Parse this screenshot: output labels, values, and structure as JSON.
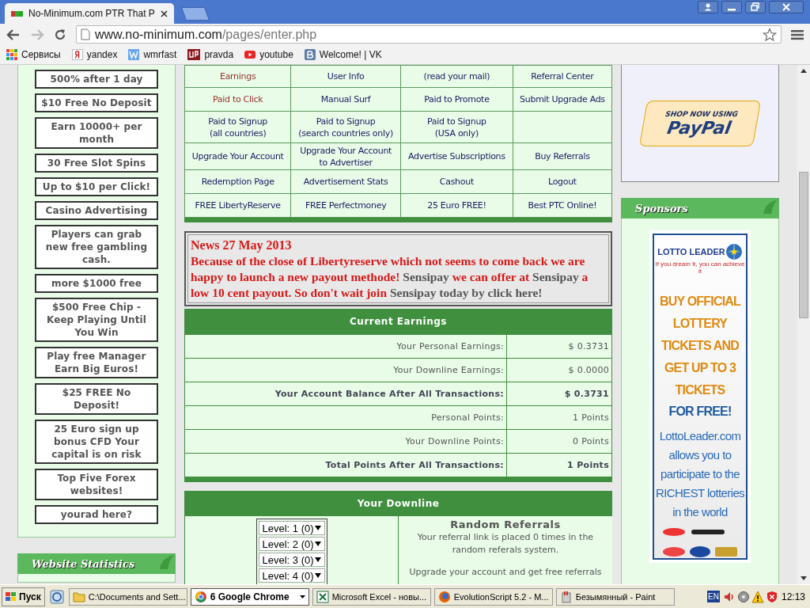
{
  "browser": {
    "tab": {
      "title": "No-Minimum.com PTR That P"
    },
    "url": {
      "host": "www.no-minimum.com",
      "path": "/pages/enter.php"
    },
    "bookmarks": [
      {
        "label": "Сервисы",
        "kind": "apps"
      },
      {
        "label": "yandex",
        "kind": "yandex"
      },
      {
        "label": "wmrfast",
        "kind": "w"
      },
      {
        "label": "pravda",
        "kind": "up"
      },
      {
        "label": "youtube",
        "kind": "youtube"
      },
      {
        "label": "Welcome! | VK",
        "kind": "vk"
      }
    ]
  },
  "left": {
    "banners": [
      "500% after 1 day",
      "$10 Free No Deposit",
      "Earn 10000+ per month",
      "30 Free Slot Spins",
      "Up to $10 per Click!",
      "Casino Advertising",
      "Players can grab new free gambling cash.",
      "more $1000 free",
      "$500 Free Chip - Keep Playing Until You Win",
      "Play free Manager Earn Big Euros!",
      "$25 FREE No Deposit!",
      "25 Euro sign up bonus CFD Your capital is on risk",
      "Top Five Forex websites!",
      "yourad here?"
    ],
    "stats_title": "Website Statistics"
  },
  "nav": {
    "rows": [
      [
        {
          "label": "Earnings",
          "visited": true
        },
        {
          "label": "User Info",
          "visited": false
        },
        {
          "label": "(read your mail)",
          "visited": false
        },
        {
          "label": "Referral Center",
          "visited": false
        }
      ],
      [
        {
          "label": "Paid to Click",
          "visited": true
        },
        {
          "label": "Manual Surf",
          "visited": false
        },
        {
          "label": "Paid to Promote",
          "visited": false
        },
        {
          "label": "Submit Upgrade Ads",
          "visited": false
        }
      ],
      [
        {
          "label": "Paid to Signup\n(all countries)",
          "visited": false
        },
        {
          "label": "Paid to Signup\n(search countries only)",
          "visited": false
        },
        {
          "label": "Paid to Signup\n(USA only)",
          "visited": false
        },
        null
      ],
      [
        {
          "label": "Upgrade Your Account",
          "visited": false
        },
        {
          "label": "Upgrade Your Account\nto Advertiser",
          "visited": false
        },
        {
          "label": "Advertise Subscriptions",
          "visited": false
        },
        {
          "label": "Buy Referrals",
          "visited": false
        }
      ],
      [
        {
          "label": "Redemption Page",
          "visited": false
        },
        {
          "label": "Advertisement Stats",
          "visited": false
        },
        {
          "label": "Cashout",
          "visited": false
        },
        {
          "label": "Logout",
          "visited": false
        }
      ],
      [
        {
          "label": "FREE LibertyReserve",
          "visited": false
        },
        {
          "label": "FREE Perfectmoney",
          "visited": false
        },
        {
          "label": "25 Euro FREE!",
          "visited": false
        },
        {
          "label": "Best PTC Online!",
          "visited": false
        }
      ]
    ]
  },
  "news": {
    "title": "News 27 May 2013",
    "segments": [
      {
        "kind": "text",
        "text": "Because of the close of Libertyreserve which not seems to come back we are happy to launch a new payout methode!"
      },
      {
        "kind": "link",
        "text": "Sensipay"
      },
      {
        "kind": "text",
        "text": "we can offer at"
      },
      {
        "kind": "link",
        "text": "Sensipay"
      },
      {
        "kind": "text",
        "text": "a low 10 cent payout. So don't wait join"
      },
      {
        "kind": "link",
        "text": "Sensipay today by click here!"
      }
    ]
  },
  "earnings": {
    "title": "Current Earnings",
    "rows": [
      {
        "label": "Your Personal Earnings:",
        "value": "$  0.3731",
        "bold": false
      },
      {
        "label": "Your Downline Earnings:",
        "value": "$  0.0000",
        "bold": false
      },
      {
        "label": "Your Account Balance After All Transactions:",
        "value": "$  0.3731",
        "bold": true
      },
      {
        "label": "Personal Points:",
        "value": "1 Points",
        "bold": false
      },
      {
        "label": "Your Downline Points:",
        "value": "0 Points",
        "bold": false
      },
      {
        "label": "Total Points After All Transactions:",
        "value": "1 Points",
        "bold": true
      }
    ]
  },
  "downline": {
    "title": "Your Downline",
    "levels": [
      "Level: 1 (0)",
      "Level: 2 (0)",
      "Level: 3 (0)",
      "Level: 4 (0)"
    ],
    "random": {
      "title": "Random Referrals",
      "text": "Your referral link is placed 0 times in the random referals system.",
      "upgrade": "Upgrade your account and get free referrals"
    }
  },
  "right": {
    "paypal": {
      "top": "SHOP NOW USING",
      "brand": "PayPal"
    },
    "sponsors_title": "Sponsors",
    "ad": {
      "logo": "LOTTO LEADER",
      "slogan": "If you dream it, you can achieve it",
      "headline": "BUY OFFICIAL LOTTERY TICKETS AND GET UP TO 3 TICKETS",
      "free": "FOR FREE!",
      "body": "LottoLeader.com allows you to participate to the RICHEST lotteries in the world"
    }
  },
  "taskbar": {
    "start": "Пуск",
    "items": [
      {
        "label": "C:\\Documents and Sett...",
        "kind": "folder",
        "selected": false
      },
      {
        "label": "6 Google Chrome",
        "kind": "chrome",
        "selected": true
      },
      {
        "label": "Microsoft Excel - новы...",
        "kind": "excel",
        "selected": false
      },
      {
        "label": "EvolutionScript 5.2 - M...",
        "kind": "firefox",
        "selected": false
      },
      {
        "label": "Безымянный - Paint",
        "kind": "paint",
        "selected": false
      }
    ],
    "lang": "EN",
    "time": "12:13"
  }
}
